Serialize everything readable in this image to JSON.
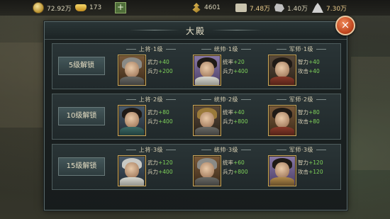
{
  "topbar": {
    "coin": "72.92万",
    "ingot": "173",
    "plus": "+",
    "food": "4601",
    "wood": "7.48万",
    "stone": "1.40万",
    "iron": "7.30万"
  },
  "panel": {
    "title": "大殿",
    "close": "×"
  },
  "tiers": [
    {
      "label": "5级解锁",
      "slots": [
        {
          "title": "上将·1级",
          "stats": [
            {
              "name": "武力",
              "value": "+40"
            },
            {
              "name": "兵力",
              "value": "+200"
            }
          ]
        },
        {
          "title": "统帅·1级",
          "stats": [
            {
              "name": "统率",
              "value": "+20"
            },
            {
              "name": "兵力",
              "value": "+400"
            }
          ]
        },
        {
          "title": "军师·1级",
          "stats": [
            {
              "name": "智力",
              "value": "+40"
            },
            {
              "name": "攻击",
              "value": "+40"
            }
          ]
        }
      ]
    },
    {
      "label": "10级解锁",
      "slots": [
        {
          "title": "上将·2级",
          "stats": [
            {
              "name": "武力",
              "value": "+80"
            },
            {
              "name": "兵力",
              "value": "+400"
            }
          ]
        },
        {
          "title": "统帅·2级",
          "stats": [
            {
              "name": "统率",
              "value": "+40"
            },
            {
              "name": "兵力",
              "value": "+800"
            }
          ]
        },
        {
          "title": "军师·2级",
          "stats": [
            {
              "name": "智力",
              "value": "+80"
            },
            {
              "name": "攻击",
              "value": "+80"
            }
          ]
        }
      ]
    },
    {
      "label": "15级解锁",
      "slots": [
        {
          "title": "上将·3级",
          "stats": [
            {
              "name": "武力",
              "value": "+120"
            },
            {
              "name": "兵力",
              "value": "+400"
            }
          ]
        },
        {
          "title": "统帅·3级",
          "stats": [
            {
              "name": "统率",
              "value": "+60"
            },
            {
              "name": "兵力",
              "value": "+800"
            }
          ]
        },
        {
          "title": "军师·3级",
          "stats": [
            {
              "name": "智力",
              "value": "+120"
            },
            {
              "name": "攻击",
              "value": "+120"
            }
          ]
        }
      ]
    }
  ],
  "colors": {
    "stat_value": "#7fd35a",
    "close_button": "#c0461e",
    "portrait_border": "#c9a55b"
  },
  "icons": [
    "coin-icon",
    "ingot-icon",
    "plus-icon",
    "food-icon",
    "wood-icon",
    "stone-icon",
    "iron-icon",
    "close-icon"
  ]
}
